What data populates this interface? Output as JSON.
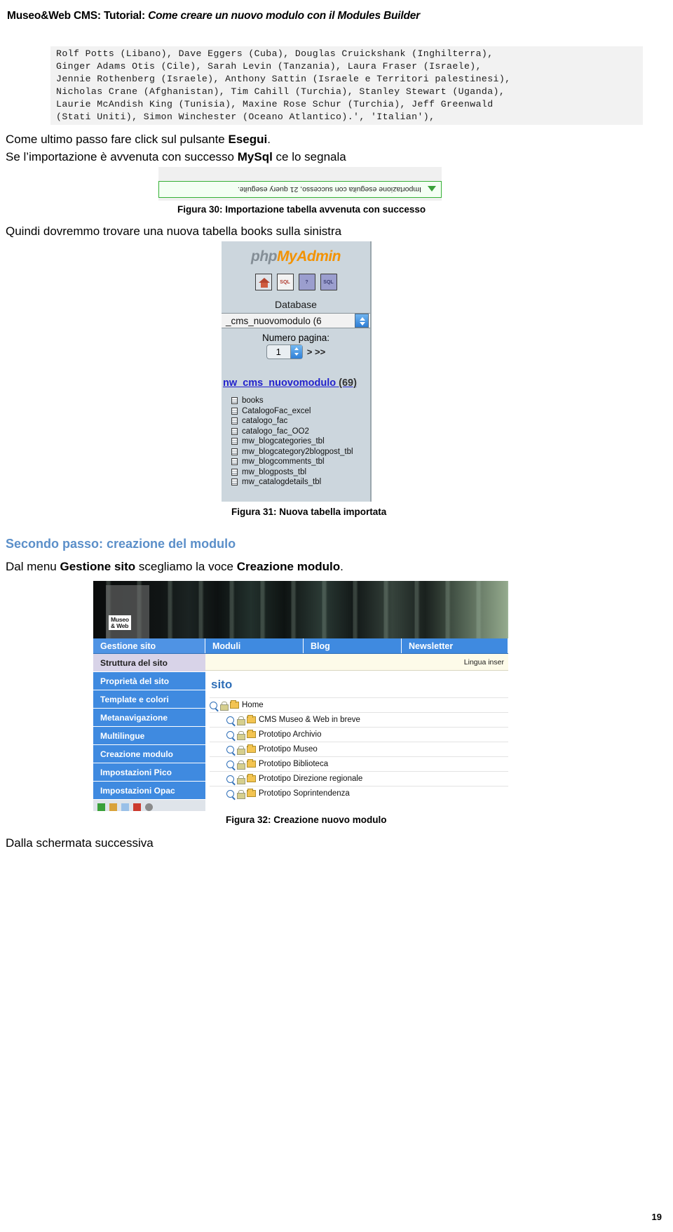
{
  "header": {
    "prefix": "Museo&Web CMS: Tutorial: ",
    "italic": "Come creare un nuovo modulo con il Modules Builder"
  },
  "code_block": {
    "text": "Rolf Potts (Libano), Dave Eggers (Cuba), Douglas Cruickshank (Inghilterra),\nGinger Adams Otis (Cile), Sarah Levin (Tanzania), Laura Fraser (Israele),\nJennie Rothenberg (Israele), Anthony Sattin (Israele e Territori palestinesi),\nNicholas Crane (Afghanistan), Tim Cahill (Turchia), Stanley Stewart (Uganda),\nLaurie McAndish King (Tunisia), Maxine Rose Schur (Turchia), Jeff Greenwald\n(Stati Uniti), Simon Winchester (Oceano Atlantico).', 'Italian'),"
  },
  "paragraphs": {
    "p1_a": "Come ultimo passo fare click sul pulsante ",
    "p1_b": "Esegui",
    "p1_c": ".",
    "p2_a": "Se l’importazione è avvenuta con successo ",
    "p2_b": "MySql",
    "p2_c": " ce lo segnala",
    "p3": "Quindi dovremmo trovare una nuova tabella books sulla sinistra",
    "p5_a": "Dal menu ",
    "p5_b": "Gestione sito",
    "p5_c": " scegliamo la voce ",
    "p5_d": "Creazione modulo",
    "p5_e": ".",
    "p6": "Dalla schermata successiva"
  },
  "section_heading": "Secondo passo: creazione del modulo",
  "captions": {
    "fig30": "Figura 30: Importazione tabella avvenuta con successo",
    "fig31": "Figura 31: Nuova tabella importata",
    "fig32": "Figura 32: Creazione nuovo modulo"
  },
  "fig30": {
    "message": "Importazione eseguita con successo, 21 query eseguite."
  },
  "fig31": {
    "logo_gray": "php",
    "logo_orange": "MyAdmin",
    "icons": [
      "home-icon",
      "sql-window-icon",
      "help-bubble-icon",
      "sql-bubble-icon"
    ],
    "icon_labels": [
      "",
      "SQL",
      "?",
      "SQL"
    ],
    "database_label": "Database",
    "database_selected": "_cms_nuovomodulo (6",
    "page_number_label": "Numero pagina:",
    "page_number_value": "1",
    "page_nav": "> >>",
    "db_link": "nw_cms_nuovomodulo",
    "db_count": " (69)",
    "tables": [
      "books",
      "CatalogoFac_excel",
      "catalogo_fac",
      "catalogo_fac_OO2",
      "mw_blogcategories_tbl",
      "mw_blogcategory2blogpost_tbl",
      "mw_blogcomments_tbl",
      "mw_blogposts_tbl",
      "mw_catalogdetails_tbl"
    ]
  },
  "fig32": {
    "logo_text": "Museo\n& Web",
    "logo_line1": "Museo",
    "logo_line2": "& Web",
    "tabs": [
      {
        "label": "Gestione sito",
        "active": true
      },
      {
        "label": "Moduli",
        "active": false
      },
      {
        "label": "Blog",
        "active": false
      },
      {
        "label": "Newsletter",
        "active": false
      }
    ],
    "sidebar": [
      {
        "label": "Struttura del sito",
        "active": true
      },
      {
        "label": "Proprietà del sito",
        "active": false
      },
      {
        "label": "Template e colori",
        "active": false
      },
      {
        "label": "Metanavigazione",
        "active": false
      },
      {
        "label": "Multilingue",
        "active": false
      },
      {
        "label": "Creazione modulo",
        "active": false
      },
      {
        "label": "Impostazioni Pico",
        "active": false
      },
      {
        "label": "Impostazioni Opac",
        "active": false
      }
    ],
    "toolbar_icons": [
      "add-icon",
      "edit-icon",
      "copy-icon",
      "delete-icon",
      "settings-icon"
    ],
    "lingua_label": "Lingua inser",
    "main_title": "sito",
    "tree": [
      {
        "label": "Home",
        "indent": false
      },
      {
        "label": "CMS Museo & Web in breve",
        "indent": true
      },
      {
        "label": "Prototipo Archivio",
        "indent": true
      },
      {
        "label": "Prototipo Museo",
        "indent": true
      },
      {
        "label": "Prototipo Biblioteca",
        "indent": true
      },
      {
        "label": "Prototipo Direzione regionale",
        "indent": true
      },
      {
        "label": "Prototipo Soprintendenza",
        "indent": true
      }
    ]
  },
  "page_number": "19",
  "colors": {
    "accent_blue": "#3f8ae0",
    "heading_blue": "#5b8fc9",
    "success_green": "#35b035",
    "pma_orange": "#f39200"
  }
}
